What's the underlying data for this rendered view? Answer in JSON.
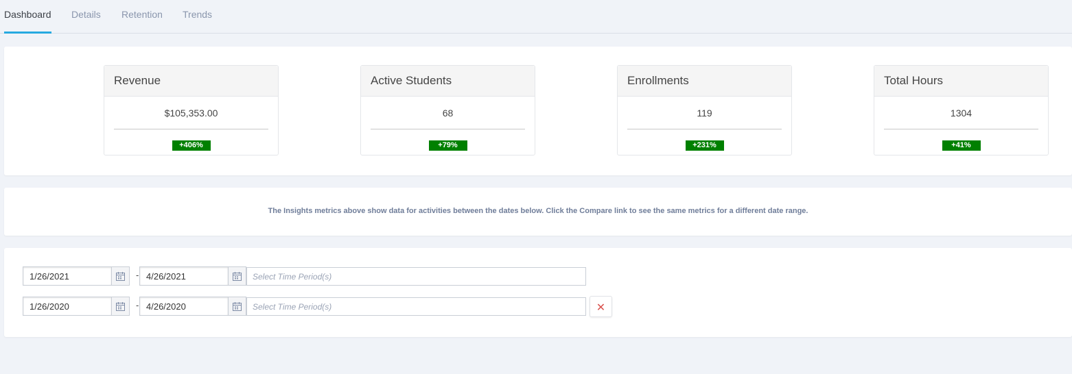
{
  "tabs": [
    {
      "label": "Dashboard",
      "active": true
    },
    {
      "label": "Details",
      "active": false
    },
    {
      "label": "Retention",
      "active": false
    },
    {
      "label": "Trends",
      "active": false
    }
  ],
  "metrics": [
    {
      "title": "Revenue",
      "value": "$105,353.00",
      "change": "+406%"
    },
    {
      "title": "Active Students",
      "value": "68",
      "change": "+79%"
    },
    {
      "title": "Enrollments",
      "value": "119",
      "change": "+231%"
    },
    {
      "title": "Total Hours",
      "value": "1304",
      "change": "+41%"
    }
  ],
  "info": {
    "text": "The Insights metrics above show data for activities between the dates below. Click the Compare link to see the same metrics for a different date range."
  },
  "date_ranges": [
    {
      "start": "1/26/2021",
      "separator": "-",
      "end": "4/26/2021",
      "period_placeholder": "Select Time Period(s)"
    },
    {
      "start": "1/26/2020",
      "separator": "-",
      "end": "4/26/2020",
      "period_placeholder": "Select Time Period(s)",
      "remove_label": "✕"
    }
  ],
  "colors": {
    "active_tab_underline": "#26a9e0",
    "badge_positive": "#008000",
    "remove_icon": "#d9534f"
  }
}
